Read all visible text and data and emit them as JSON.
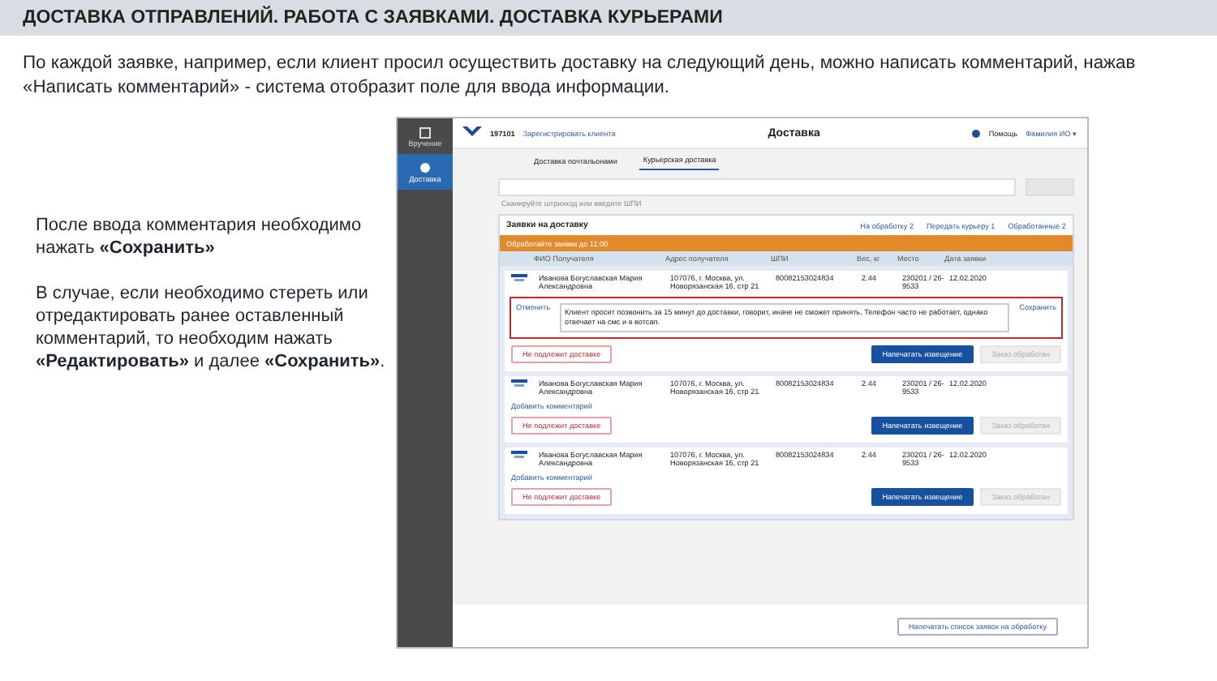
{
  "slide": {
    "title": "ДОСТАВКА ОТПРАВЛЕНИЙ. РАБОТА С ЗАЯВКАМИ. ДОСТАВКА КУРЬЕРАМИ",
    "intro": "По каждой заявке, например, если клиент просил осуществить доставку на следующий день, можно написать комментарий, нажав «Написать комментарий» -  система отобразит поле для ввода информации.",
    "notes": [
      "После ввода комментария необходимо нажать **«Сохранить»**",
      "В случае, если необходимо стереть или отредактировать ранее оставленный комментарий, то необходим нажать **«Редактировать»** и далее **«Сохранить»**."
    ]
  },
  "app": {
    "sidebar": [
      {
        "label": "Вручение",
        "selected": false
      },
      {
        "label": "Доставка",
        "selected": true
      }
    ],
    "header": {
      "office": "197101",
      "register": "Зарегистрировать клиента",
      "title": "Доставка",
      "help": "Помощь",
      "user": "Фамилия ИО ▾"
    },
    "tabs": [
      {
        "label": "Доставка почтальонами",
        "selected": false
      },
      {
        "label": "Курьерская доставка",
        "selected": true
      }
    ],
    "search": {
      "hint": "Сканируйте штрихкод или введите ШПИ"
    },
    "panel": {
      "title": "Заявки на доставку",
      "filters": [
        "На обработку 2",
        "Передать курьеру 1",
        "Обработанные 2"
      ],
      "alert": "Обработайте заявки до 11:00",
      "columns": [
        "ФИО Получателя",
        "Адрес получателя",
        "ШПИ",
        "Вес, кг",
        "Место",
        "Дата заявки"
      ],
      "orders": [
        {
          "cells": [
            "Иванова Богуславская Мария Александровна",
            "107076, г. Москва, ул. Новорязанская 16, стр 21",
            "80082153024834",
            "2.44",
            "230201 / 26-9533",
            "12.02.2020"
          ],
          "comment_open": true,
          "cancel": "Отменить",
          "comment": "Клиент просит позвонить за 15 минут до доставки, говорит, иначе не сможет принять. Телефон часто не работает, однако отвечает на смс и в вотсап.",
          "save": "Сохранить",
          "reject": "Не подлежит доставке",
          "print": "Напечатать извещение",
          "done": "Заказ обработан"
        },
        {
          "cells": [
            "Иванова Богуславская Мария Александровна",
            "107076, г. Москва, ул. Новорязанская 16, стр 21",
            "80082153024834",
            "2.44",
            "230201 / 26-9533",
            "12.02.2020"
          ],
          "comment_open": false,
          "add": "Добавить комментарий",
          "reject": "Не подлежит доставке",
          "print": "Напечатать извещение",
          "done": "Заказ обработан"
        },
        {
          "cells": [
            "Иванова Богуславская Мария Александровна",
            "107076, г. Москва, ул. Новорязанская 16, стр 21",
            "80082153024834",
            "2.44",
            "230201 / 26-9533",
            "12.02.2020"
          ],
          "comment_open": false,
          "add": "Добавить комментарий",
          "reject": "Не подлежит доставке",
          "print": "Напечатать извещение",
          "done": "Заказ обработан"
        }
      ]
    },
    "print_list": "Напечатать список заявок на обработку"
  }
}
